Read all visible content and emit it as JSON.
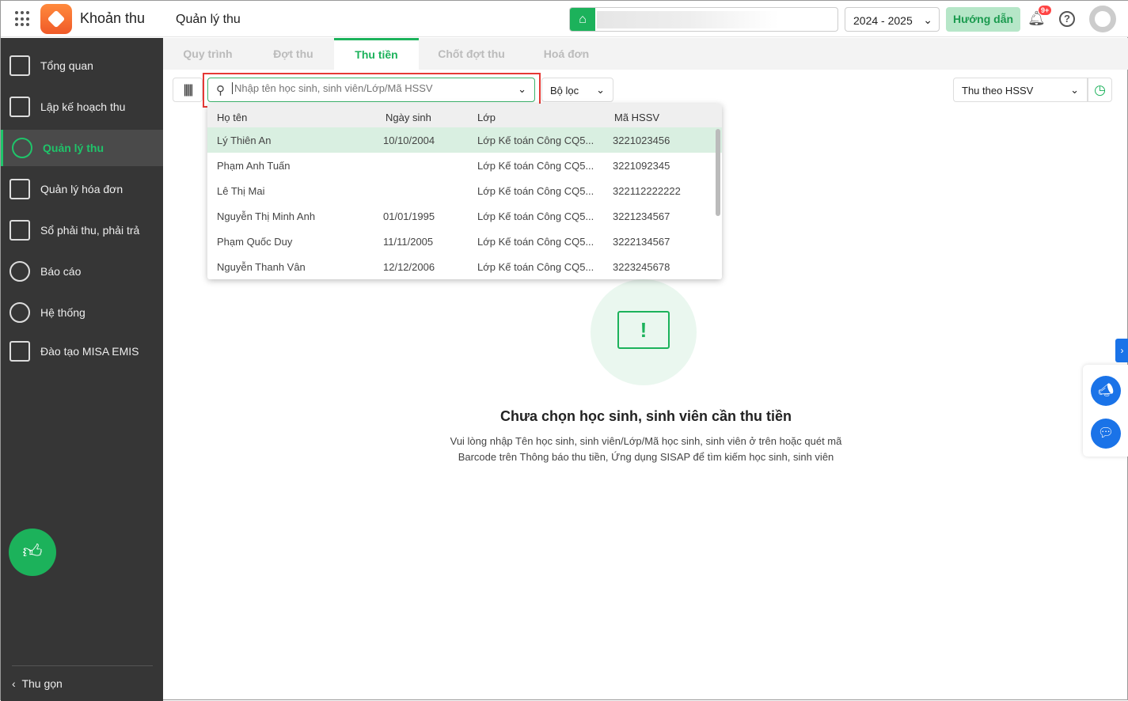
{
  "header": {
    "app_name": "Khoản thu",
    "page_title": "Quản lý thu",
    "year": "2024 - 2025",
    "guide_label": "Hướng dẫn",
    "notification_badge": "9+"
  },
  "sidebar": {
    "items": [
      {
        "label": "Tổng quan"
      },
      {
        "label": "Lập kế hoạch thu"
      },
      {
        "label": "Quản lý thu"
      },
      {
        "label": "Quản lý hóa đơn"
      },
      {
        "label": "Sổ phải thu, phải trả"
      },
      {
        "label": "Báo cáo"
      },
      {
        "label": "Hệ thống"
      },
      {
        "label": "Đào tạo MISA EMIS"
      }
    ],
    "collapse_label": "Thu gọn"
  },
  "tabs": [
    "Quy trình",
    "Đợt thu",
    "Thu tiền",
    "Chốt đợt thu",
    "Hoá đơn"
  ],
  "toolbar": {
    "search_placeholder": "Nhập tên học sinh, sinh viên/Lớp/Mã HSSV",
    "filter_label": "Bộ lọc",
    "mode_label": "Thu theo HSSV"
  },
  "dropdown": {
    "columns": [
      "Họ tên",
      "Ngày sinh",
      "Lớp",
      "Mã HSSV"
    ],
    "rows": [
      {
        "name": "Lý Thiên An",
        "dob": "10/10/2004",
        "class": "Lớp Kế toán Công CQ5...",
        "code": "3221023456"
      },
      {
        "name": "Phạm Anh Tuấn",
        "dob": "",
        "class": "Lớp Kế toán Công CQ5...",
        "code": "3221092345"
      },
      {
        "name": "Lê Thị Mai",
        "dob": "",
        "class": "Lớp Kế toán Công CQ5...",
        "code": "322112222222"
      },
      {
        "name": "Nguyễn Thị Minh Anh",
        "dob": "01/01/1995",
        "class": "Lớp Kế toán Công CQ5...",
        "code": "3221234567"
      },
      {
        "name": "Phạm Quốc Duy",
        "dob": "11/11/2005",
        "class": "Lớp Kế toán Công CQ5...",
        "code": "3222134567"
      },
      {
        "name": "Nguyễn Thanh Vân",
        "dob": "12/12/2006",
        "class": "Lớp Kế toán Công CQ5...",
        "code": "3223245678"
      }
    ]
  },
  "empty": {
    "title": "Chưa chọn học sinh, sinh viên cần thu tiền",
    "line1": "Vui lòng nhập Tên học sinh, sinh viên/Lớp/Mã học sinh, sinh viên ở trên hoặc quét mã",
    "line2": "Barcode trên Thông báo thu tiền, Ứng dụng SISAP để tìm kiếm học sinh, sinh viên"
  }
}
